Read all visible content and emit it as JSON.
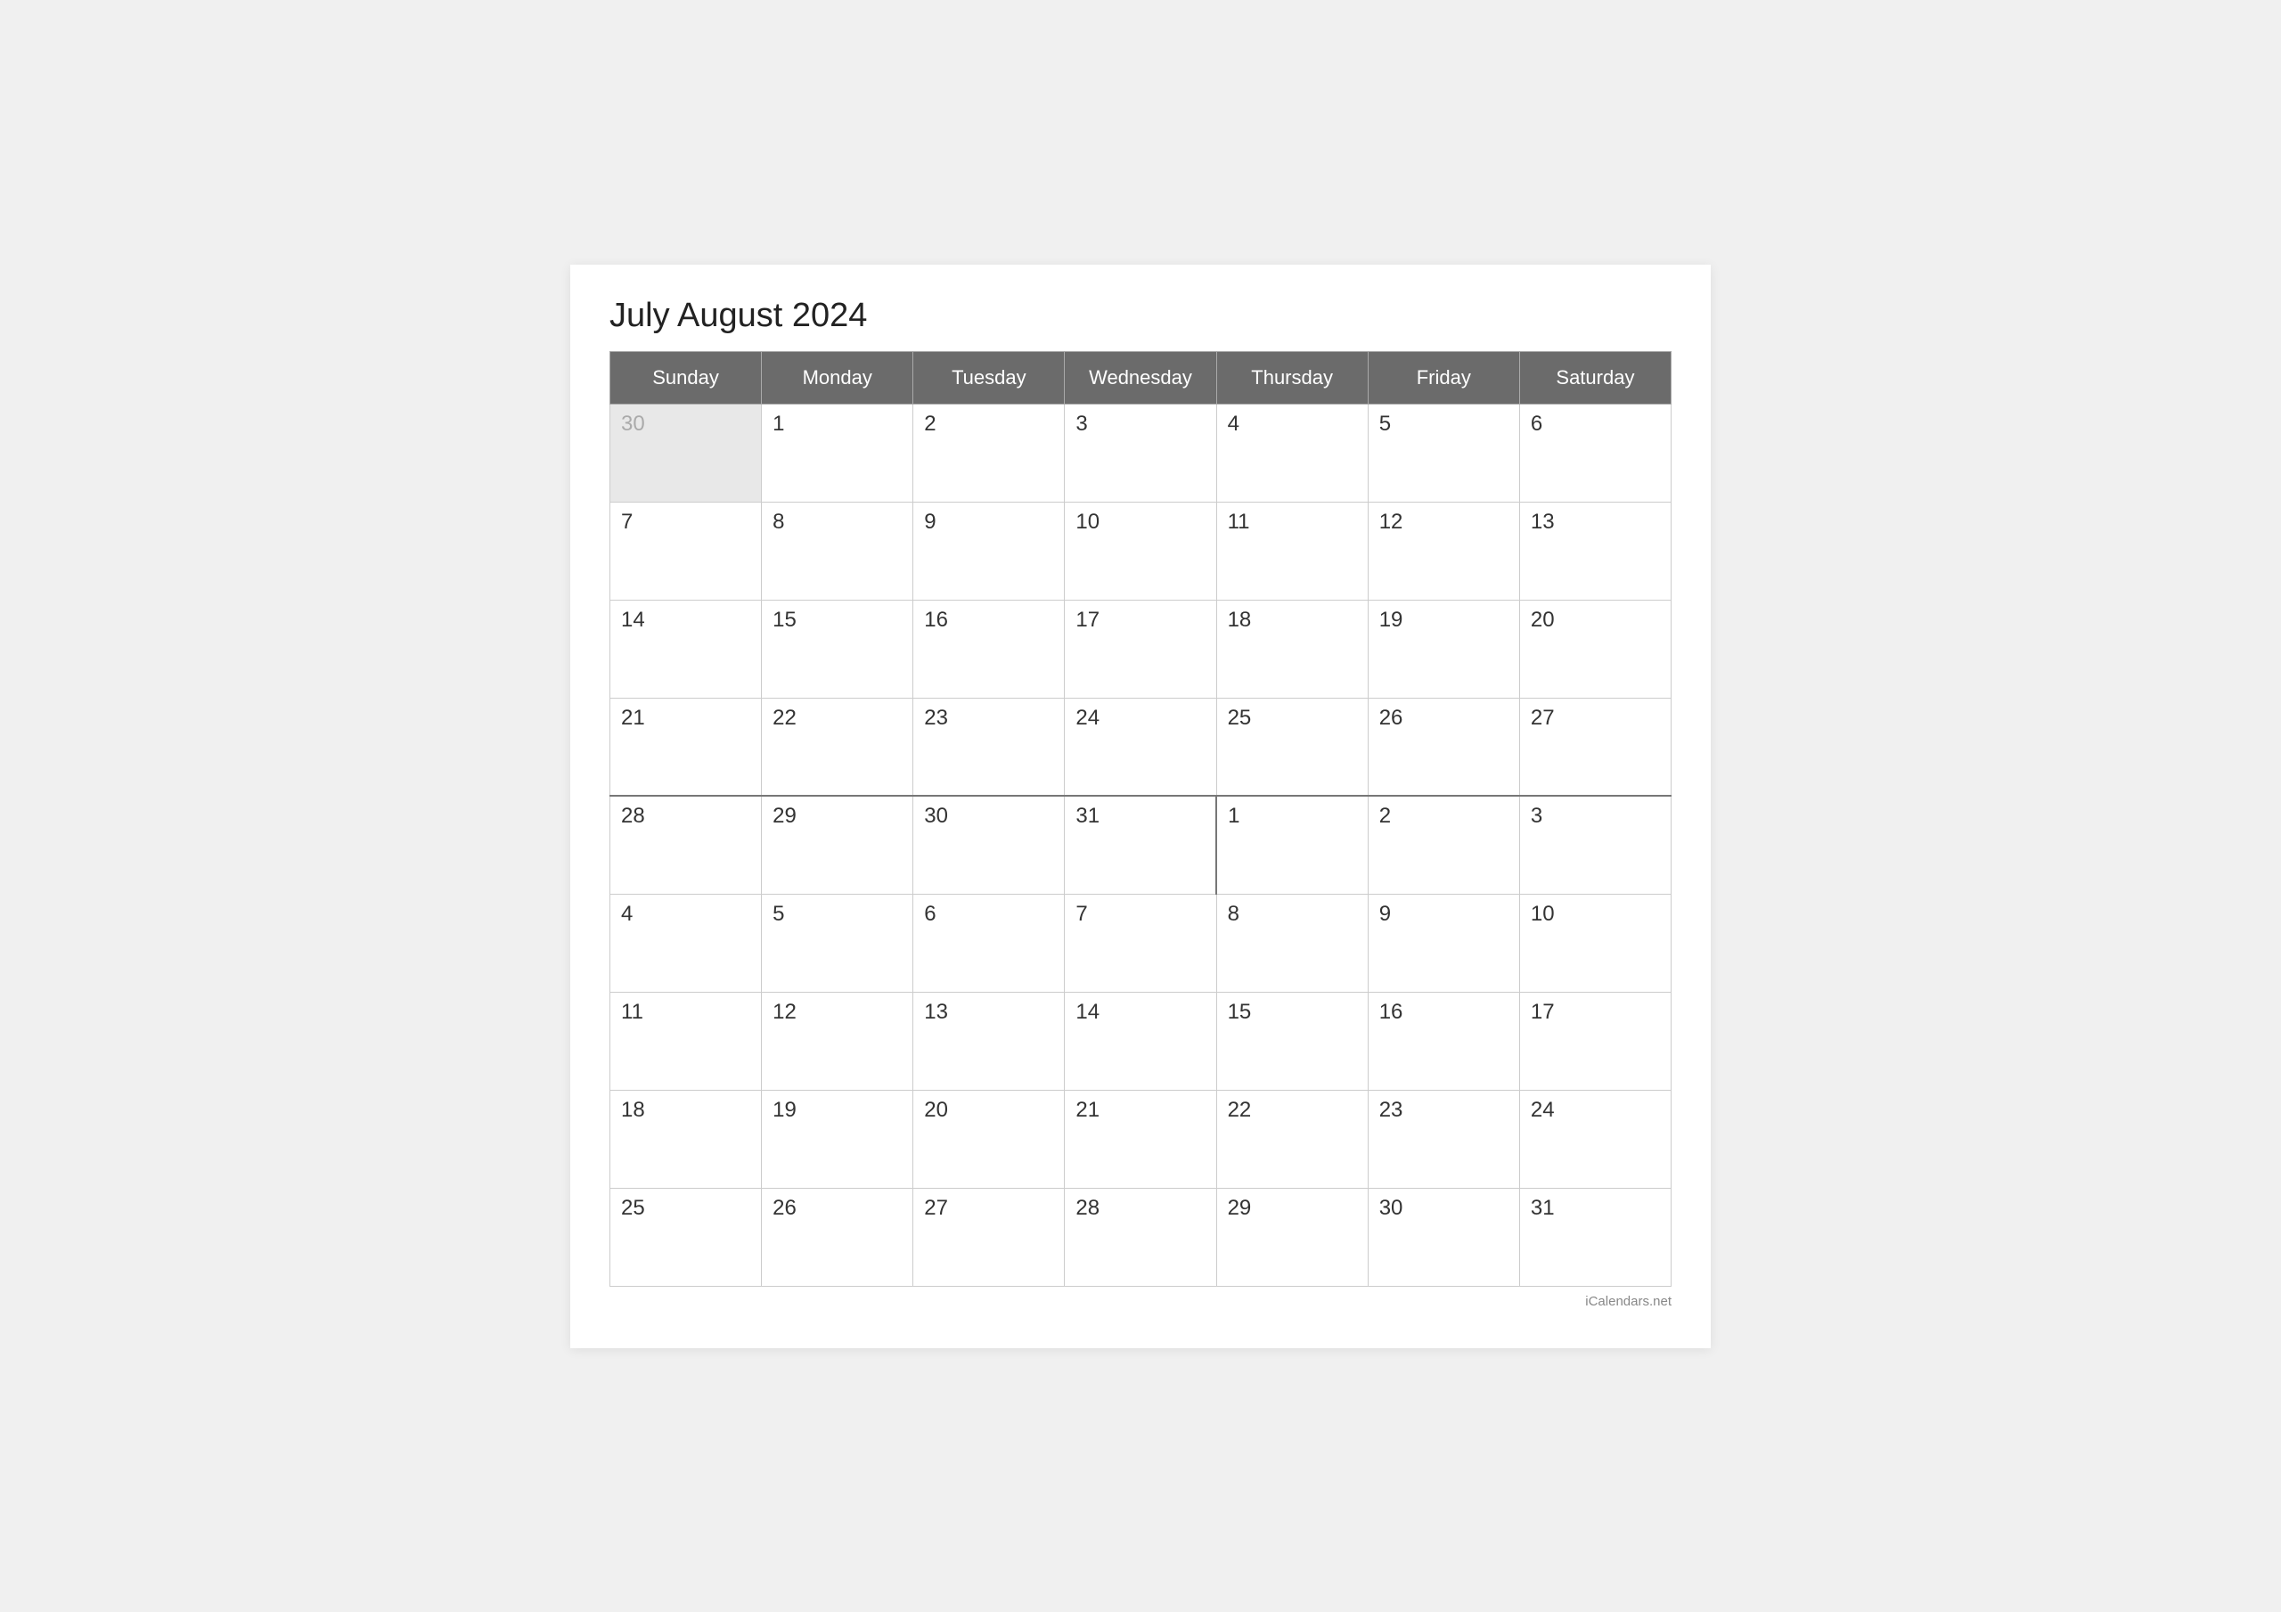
{
  "title": "July August 2024",
  "days_of_week": [
    "Sunday",
    "Monday",
    "Tuesday",
    "Wednesday",
    "Thursday",
    "Friday",
    "Saturday"
  ],
  "weeks": [
    [
      {
        "day": "30",
        "type": "prev-month"
      },
      {
        "day": "1",
        "type": "current"
      },
      {
        "day": "2",
        "type": "current"
      },
      {
        "day": "3",
        "type": "current"
      },
      {
        "day": "4",
        "type": "current"
      },
      {
        "day": "5",
        "type": "current"
      },
      {
        "day": "6",
        "type": "current"
      }
    ],
    [
      {
        "day": "7",
        "type": "current"
      },
      {
        "day": "8",
        "type": "current"
      },
      {
        "day": "9",
        "type": "current"
      },
      {
        "day": "10",
        "type": "current"
      },
      {
        "day": "11",
        "type": "current"
      },
      {
        "day": "12",
        "type": "current"
      },
      {
        "day": "13",
        "type": "current"
      }
    ],
    [
      {
        "day": "14",
        "type": "current"
      },
      {
        "day": "15",
        "type": "current"
      },
      {
        "day": "16",
        "type": "current"
      },
      {
        "day": "17",
        "type": "current"
      },
      {
        "day": "18",
        "type": "current"
      },
      {
        "day": "19",
        "type": "current"
      },
      {
        "day": "20",
        "type": "current"
      }
    ],
    [
      {
        "day": "21",
        "type": "current"
      },
      {
        "day": "22",
        "type": "current"
      },
      {
        "day": "23",
        "type": "current"
      },
      {
        "day": "24",
        "type": "current"
      },
      {
        "day": "25",
        "type": "current"
      },
      {
        "day": "26",
        "type": "current"
      },
      {
        "day": "27",
        "type": "current"
      }
    ],
    [
      {
        "day": "28",
        "type": "current"
      },
      {
        "day": "29",
        "type": "current"
      },
      {
        "day": "30",
        "type": "current"
      },
      {
        "day": "31",
        "type": "current"
      },
      {
        "day": "1",
        "type": "next-month",
        "divider": true
      },
      {
        "day": "2",
        "type": "next-month"
      },
      {
        "day": "3",
        "type": "next-month"
      }
    ],
    [
      {
        "day": "4",
        "type": "next-month"
      },
      {
        "day": "5",
        "type": "next-month"
      },
      {
        "day": "6",
        "type": "next-month"
      },
      {
        "day": "7",
        "type": "next-month"
      },
      {
        "day": "8",
        "type": "next-month"
      },
      {
        "day": "9",
        "type": "next-month"
      },
      {
        "day": "10",
        "type": "next-month"
      }
    ],
    [
      {
        "day": "11",
        "type": "next-month"
      },
      {
        "day": "12",
        "type": "next-month"
      },
      {
        "day": "13",
        "type": "next-month"
      },
      {
        "day": "14",
        "type": "next-month"
      },
      {
        "day": "15",
        "type": "next-month"
      },
      {
        "day": "16",
        "type": "next-month"
      },
      {
        "day": "17",
        "type": "next-month"
      }
    ],
    [
      {
        "day": "18",
        "type": "next-month"
      },
      {
        "day": "19",
        "type": "next-month"
      },
      {
        "day": "20",
        "type": "next-month"
      },
      {
        "day": "21",
        "type": "next-month"
      },
      {
        "day": "22",
        "type": "next-month"
      },
      {
        "day": "23",
        "type": "next-month"
      },
      {
        "day": "24",
        "type": "next-month"
      }
    ],
    [
      {
        "day": "25",
        "type": "next-month"
      },
      {
        "day": "26",
        "type": "next-month"
      },
      {
        "day": "27",
        "type": "next-month"
      },
      {
        "day": "28",
        "type": "next-month"
      },
      {
        "day": "29",
        "type": "next-month"
      },
      {
        "day": "30",
        "type": "next-month"
      },
      {
        "day": "31",
        "type": "next-month"
      }
    ]
  ],
  "footer": "iCalendars.net"
}
